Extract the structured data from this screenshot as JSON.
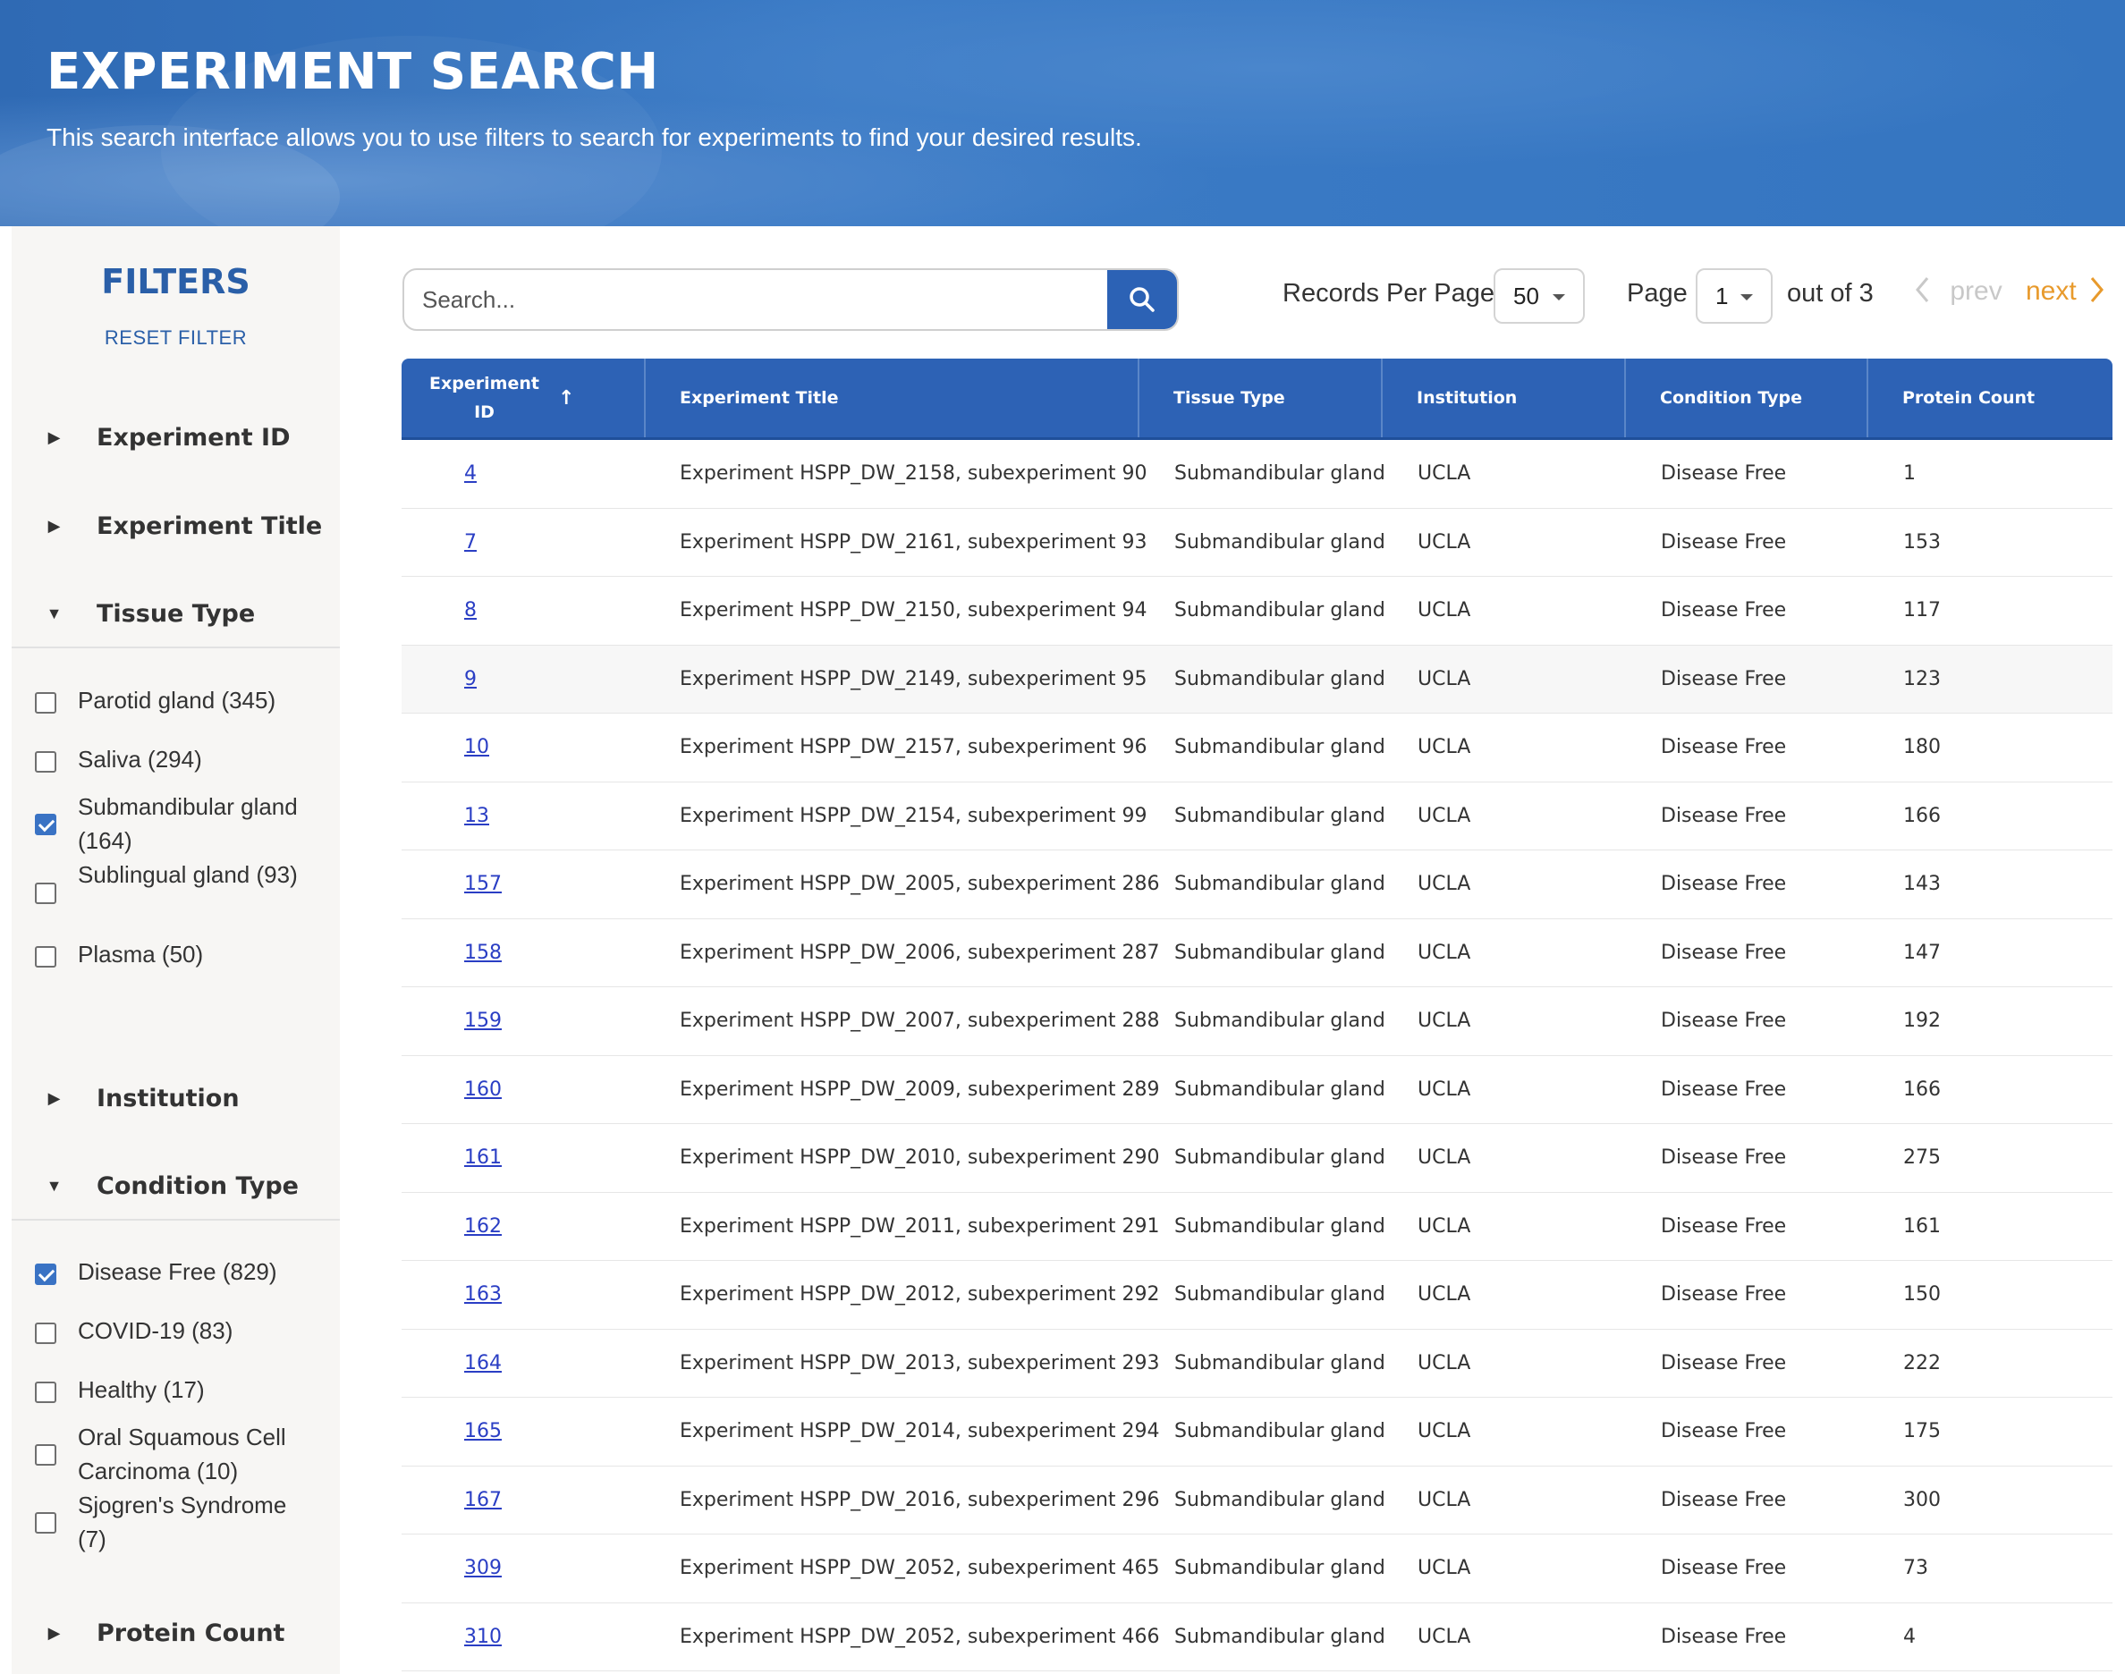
{
  "header": {
    "title": "EXPERIMENT SEARCH",
    "subtitle": "This search interface allows you to use filters to search for experiments to find your desired results."
  },
  "sidebar": {
    "title": "FILTERS",
    "reset_label": "RESET FILTER",
    "sections": {
      "experiment_id": "Experiment ID",
      "experiment_title": "Experiment Title",
      "tissue_type": "Tissue Type",
      "institution": "Institution",
      "condition_type": "Condition Type",
      "protein_count": "Protein Count"
    },
    "tissue_options": [
      {
        "label": "Parotid gland (345)",
        "checked": false
      },
      {
        "label": "Saliva (294)",
        "checked": false
      },
      {
        "label": "Submandibular gland (164)",
        "checked": true
      },
      {
        "label": "Sublingual gland (93)",
        "checked": false
      },
      {
        "label": "Plasma (50)",
        "checked": false
      }
    ],
    "condition_options": [
      {
        "label": "Disease Free (829)",
        "checked": true
      },
      {
        "label": "COVID-19 (83)",
        "checked": false
      },
      {
        "label": "Healthy (17)",
        "checked": false
      },
      {
        "label": "Oral Squamous Cell Carcinoma (10)",
        "checked": false
      },
      {
        "label": "Sjogren's Syndrome (7)",
        "checked": false
      }
    ]
  },
  "controls": {
    "search_placeholder": "Search...",
    "records_label": "Records Per Page",
    "records_value": "50",
    "page_label": "Page",
    "page_value": "1",
    "page_total": "out of 3",
    "prev_label": "prev",
    "next_label": "next"
  },
  "table": {
    "columns": [
      "Experiment ID",
      "Experiment Title",
      "Tissue Type",
      "Institution",
      "Condition Type",
      "Protein Count"
    ],
    "rows": [
      [
        "4",
        "Experiment HSPP_DW_2158, subexperiment 90",
        "Submandibular gland",
        "UCLA",
        "Disease Free",
        "1"
      ],
      [
        "7",
        "Experiment HSPP_DW_2161, subexperiment 93",
        "Submandibular gland",
        "UCLA",
        "Disease Free",
        "153"
      ],
      [
        "8",
        "Experiment HSPP_DW_2150, subexperiment 94",
        "Submandibular gland",
        "UCLA",
        "Disease Free",
        "117"
      ],
      [
        "9",
        "Experiment HSPP_DW_2149, subexperiment 95",
        "Submandibular gland",
        "UCLA",
        "Disease Free",
        "123"
      ],
      [
        "10",
        "Experiment HSPP_DW_2157, subexperiment 96",
        "Submandibular gland",
        "UCLA",
        "Disease Free",
        "180"
      ],
      [
        "13",
        "Experiment HSPP_DW_2154, subexperiment 99",
        "Submandibular gland",
        "UCLA",
        "Disease Free",
        "166"
      ],
      [
        "157",
        "Experiment HSPP_DW_2005, subexperiment 286",
        "Submandibular gland",
        "UCLA",
        "Disease Free",
        "143"
      ],
      [
        "158",
        "Experiment HSPP_DW_2006, subexperiment 287",
        "Submandibular gland",
        "UCLA",
        "Disease Free",
        "147"
      ],
      [
        "159",
        "Experiment HSPP_DW_2007, subexperiment 288",
        "Submandibular gland",
        "UCLA",
        "Disease Free",
        "192"
      ],
      [
        "160",
        "Experiment HSPP_DW_2009, subexperiment 289",
        "Submandibular gland",
        "UCLA",
        "Disease Free",
        "166"
      ],
      [
        "161",
        "Experiment HSPP_DW_2010, subexperiment 290",
        "Submandibular gland",
        "UCLA",
        "Disease Free",
        "275"
      ],
      [
        "162",
        "Experiment HSPP_DW_2011, subexperiment 291",
        "Submandibular gland",
        "UCLA",
        "Disease Free",
        "161"
      ],
      [
        "163",
        "Experiment HSPP_DW_2012, subexperiment 292",
        "Submandibular gland",
        "UCLA",
        "Disease Free",
        "150"
      ],
      [
        "164",
        "Experiment HSPP_DW_2013, subexperiment 293",
        "Submandibular gland",
        "UCLA",
        "Disease Free",
        "222"
      ],
      [
        "165",
        "Experiment HSPP_DW_2014, subexperiment 294",
        "Submandibular gland",
        "UCLA",
        "Disease Free",
        "175"
      ],
      [
        "167",
        "Experiment HSPP_DW_2016, subexperiment 296",
        "Submandibular gland",
        "UCLA",
        "Disease Free",
        "300"
      ],
      [
        "309",
        "Experiment HSPP_DW_2052, subexperiment 465",
        "Submandibular gland",
        "UCLA",
        "Disease Free",
        "73"
      ],
      [
        "310",
        "Experiment HSPP_DW_2052, subexperiment 466",
        "Submandibular gland",
        "UCLA",
        "Disease Free",
        "4"
      ]
    ]
  },
  "icons": {
    "search": "search-icon",
    "sort": "arrow-up-icon",
    "caret_closed": "caret-right-icon",
    "caret_open": "caret-down-icon",
    "prev": "chevron-left-icon",
    "next": "chevron-right-icon"
  },
  "colors": {
    "brand_blue": "#2d62b5",
    "link": "#2a3ec4",
    "next_orange": "#e89a2c",
    "checkbox_checked": "#3a73c4"
  }
}
